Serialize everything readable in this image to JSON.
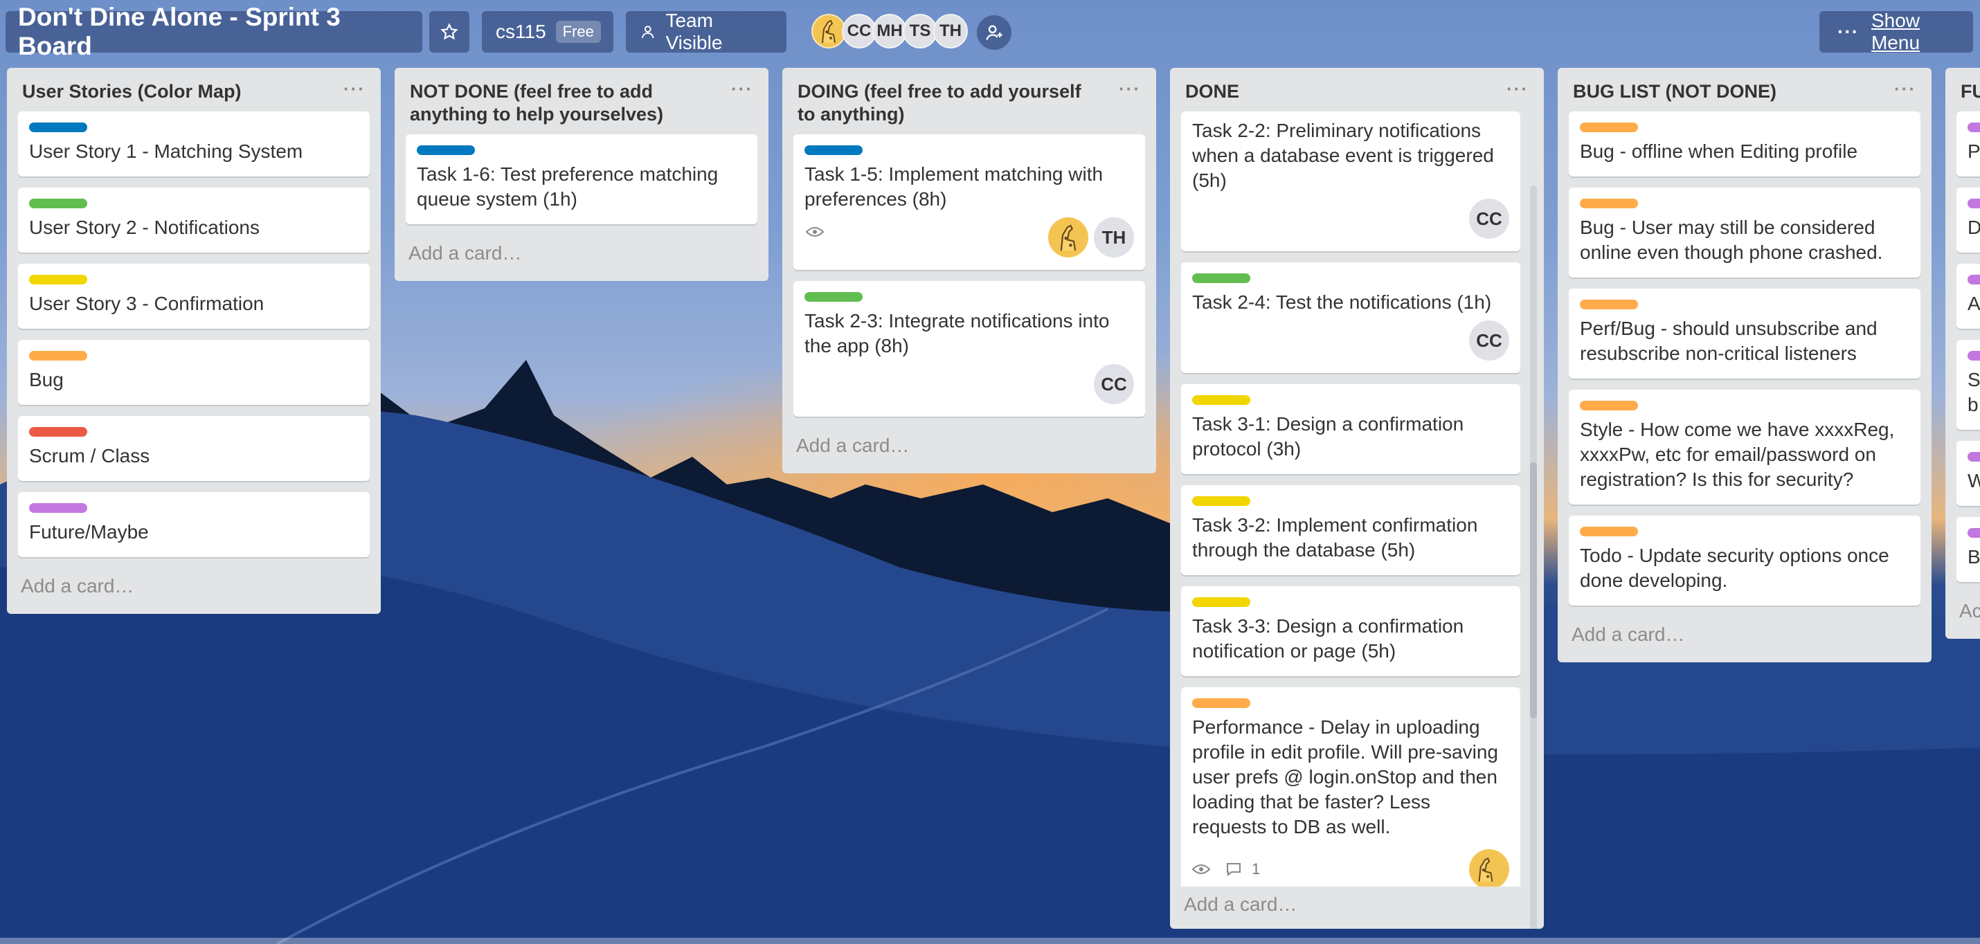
{
  "header": {
    "board_title": "Don't Dine Alone - Sprint 3 Board",
    "org_name": "cs115",
    "org_badge": "Free",
    "visibility": "Team Visible",
    "members": [
      "CC",
      "MH",
      "TS",
      "TH"
    ],
    "show_menu": "Show Menu",
    "menu_dots": "···"
  },
  "lists": [
    {
      "title": "User Stories (Color Map)",
      "add_card": "Add a card…",
      "cards": [
        {
          "label_color": "#0079bf",
          "text": "User Story 1 - Matching System"
        },
        {
          "label_color": "#61bd4f",
          "text": "User Story 2 - Notifications"
        },
        {
          "label_color": "#f2d600",
          "text": "User Story 3 - Confirmation"
        },
        {
          "label_color": "#ffab4a",
          "text": "Bug"
        },
        {
          "label_color": "#eb5a46",
          "text": "Scrum / Class"
        },
        {
          "label_color": "#c377e0",
          "text": "Future/Maybe"
        }
      ]
    },
    {
      "title": "NOT DONE (feel free to add anything to help yourselves)",
      "add_card": "Add a card…",
      "cards": [
        {
          "label_color": "#0079bf",
          "text": "Task 1-6: Test preference matching queue system (1h)"
        }
      ]
    },
    {
      "title": "DOING (feel free to add yourself to anything)",
      "add_card": "Add a card…",
      "cards": [
        {
          "label_color": "#0079bf",
          "text": "Task 1-5: Implement matching with preferences (8h)",
          "members": [
            "TH"
          ]
        },
        {
          "label_color": "#61bd4f",
          "text": "Task 2-3: Integrate notifications into the app (8h)",
          "members": [
            "CC"
          ]
        }
      ]
    },
    {
      "title": "DONE",
      "add_card": "Add a card…",
      "cards": [
        {
          "text": "Task 2-2: Preliminary notifications when a database event is triggered (5h)",
          "members": [
            "CC"
          ]
        },
        {
          "label_color": "#61bd4f",
          "text": "Task 2-4: Test the notifications (1h)",
          "members": [
            "CC"
          ]
        },
        {
          "label_color": "#f2d600",
          "text": "Task 3-1: Design a confirmation protocol (3h)"
        },
        {
          "label_color": "#f2d600",
          "text": "Task 3-2: Implement confirmation through the database (5h)"
        },
        {
          "label_color": "#f2d600",
          "text": "Task 3-3: Design a confirmation notification or page (5h)"
        },
        {
          "label_color": "#ffab4a",
          "text": "Performance - Delay in uploading profile in edit profile. Will pre-saving user prefs @ login.onStop and then loading that be faster? Less requests to DB as well.",
          "comments": "1"
        }
      ]
    },
    {
      "title": "BUG LIST (NOT DONE)",
      "add_card": "Add a card…",
      "cards": [
        {
          "label_color": "#ffab4a",
          "text": "Bug - offline when Editing profile"
        },
        {
          "label_color": "#ffab4a",
          "text": "Bug - User may still be considered online even though phone crashed."
        },
        {
          "label_color": "#ffab4a",
          "text": "Perf/Bug - should unsubscribe and resubscribe non-critical listeners"
        },
        {
          "label_color": "#ffab4a",
          "text": "Style - How come we have xxxxReg, xxxxPw, etc for email/password on registration? Is this for security?"
        },
        {
          "label_color": "#ffab4a",
          "text": "Todo - Update security options once done developing."
        }
      ]
    },
    {
      "title": "FU",
      "add_card": "Ac",
      "cards": [
        {
          "label_color": "#c377e0",
          "text": "P"
        },
        {
          "label_color": "#c377e0",
          "text": "D"
        },
        {
          "label_color": "#c377e0",
          "text": "A"
        },
        {
          "label_color": "#c377e0",
          "text": "S b"
        },
        {
          "label_color": "#c377e0",
          "text": "W"
        },
        {
          "label_color": "#c377e0",
          "text": "B"
        }
      ]
    }
  ]
}
